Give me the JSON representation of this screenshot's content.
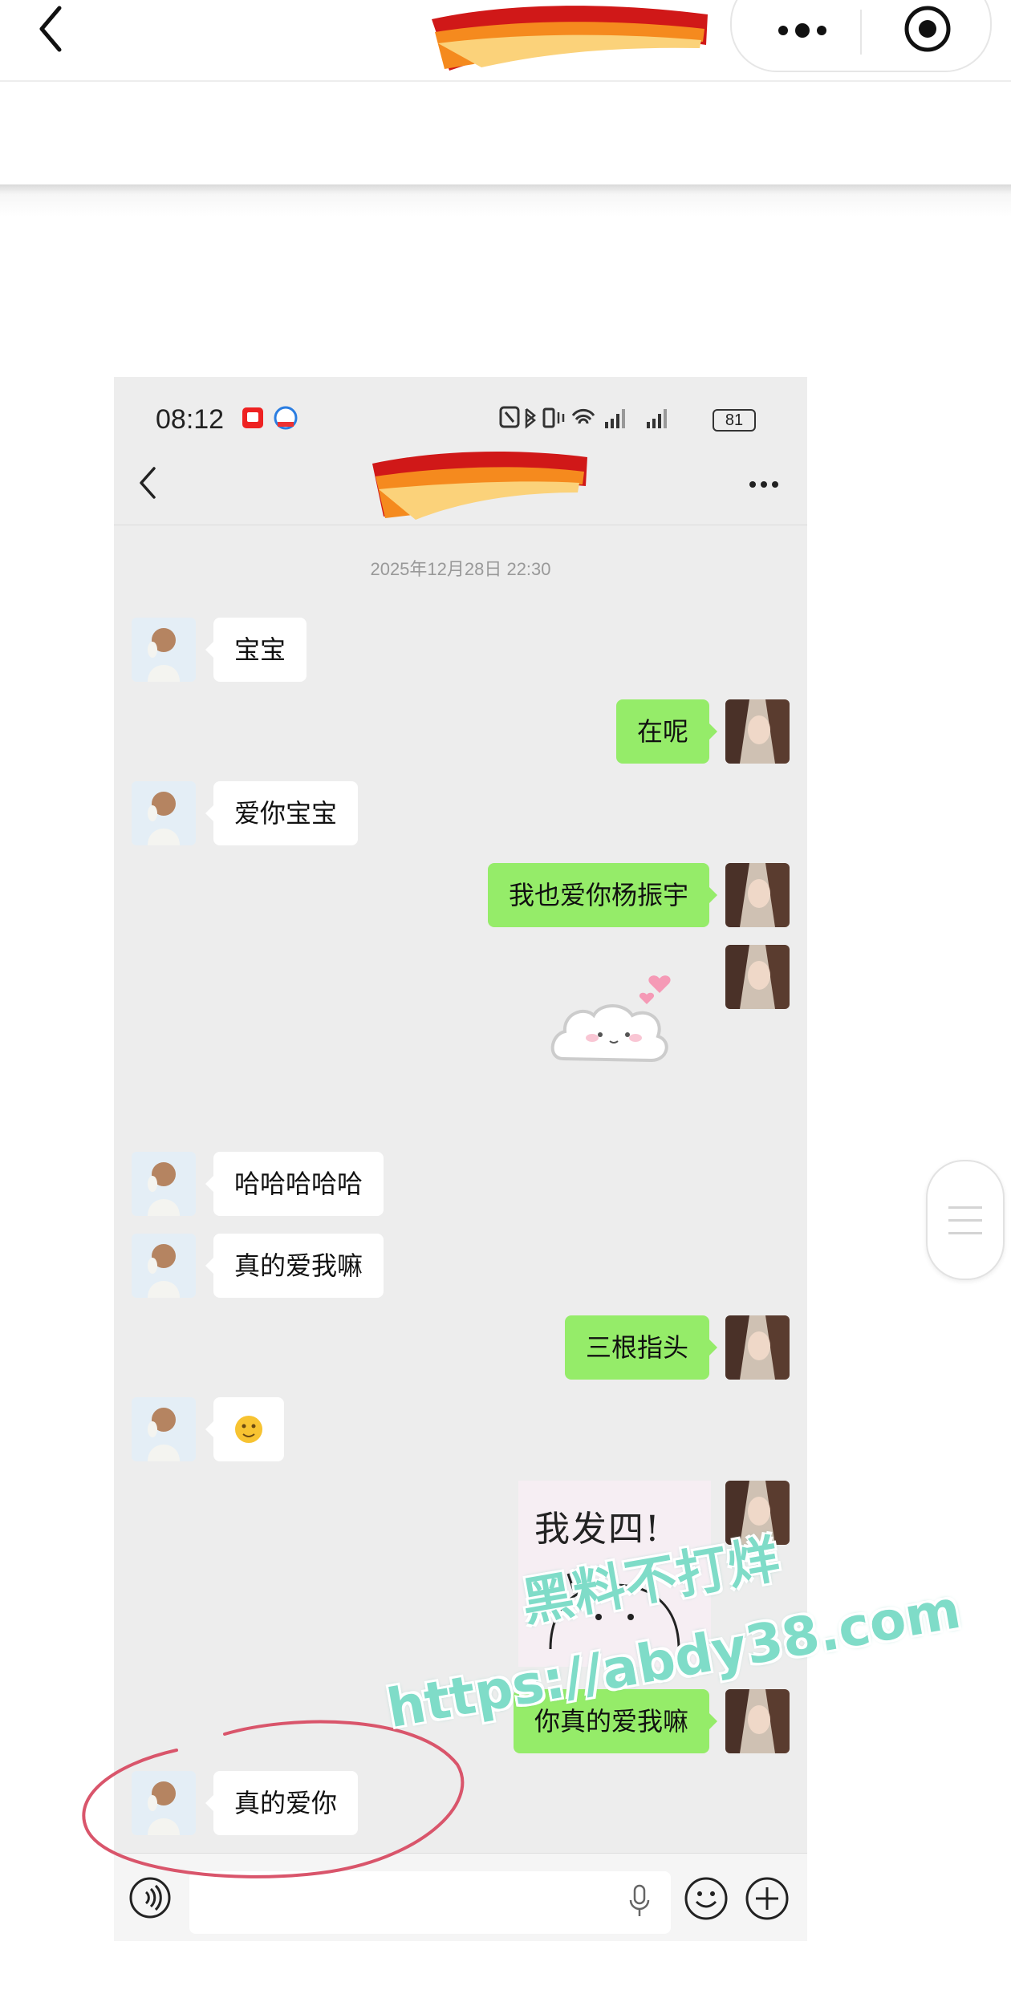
{
  "phone": {
    "status_time": "08:12",
    "battery": "81",
    "timestamp": "2025年12月28日 22:30"
  },
  "messages": [
    {
      "side": "left",
      "text": "宝宝"
    },
    {
      "side": "right",
      "text": "在呢"
    },
    {
      "side": "left",
      "text": "爱你宝宝"
    },
    {
      "side": "right",
      "text": "我也爱你杨振宇"
    },
    {
      "side": "right",
      "type": "sticker",
      "icon": "bunny-sticker"
    },
    {
      "side": "left",
      "text": "哈哈哈哈哈"
    },
    {
      "side": "left",
      "text": "真的爱我嘛"
    },
    {
      "side": "right",
      "text": "三根指头"
    },
    {
      "side": "left",
      "type": "emoji",
      "icon": "smiling-emoji"
    },
    {
      "side": "right",
      "type": "sticker",
      "text": "我发四!"
    },
    {
      "side": "right",
      "text": "你真的爱我嘛"
    },
    {
      "side": "left",
      "text": "真的爱你"
    }
  ],
  "watermark": {
    "line1": "黑料不打烊",
    "line2": "https://abdy38.com"
  },
  "colors": {
    "sent_bubble": "#95ec69",
    "received_bubble": "#ffffff",
    "chat_bg": "#ededed",
    "watermark": "#7fdcc8",
    "annotation_circle": "#d9556b"
  }
}
